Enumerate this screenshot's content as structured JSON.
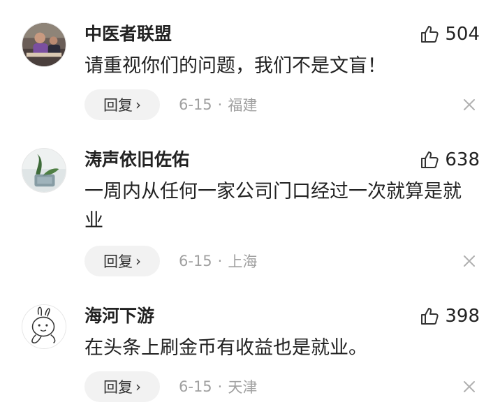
{
  "comments": [
    {
      "username": "中医者联盟",
      "likes": "504",
      "text": "请重视你们的问题，我们不是文盲！",
      "reply_label": "回复",
      "chevron": "›",
      "date": "6-15",
      "separator": "·",
      "location": "福建",
      "avatar_icon": "photo-avatar"
    },
    {
      "username": "涛声依旧佐佑",
      "likes": "638",
      "text": "一周内从任何一家公司门口经过一次就算是就业",
      "reply_label": "回复",
      "chevron": "›",
      "date": "6-15",
      "separator": "·",
      "location": "上海",
      "avatar_icon": "plant-avatar"
    },
    {
      "username": "海河下游",
      "likes": "398",
      "text": "在头条上刷金币有收益也是就业。",
      "reply_label": "回复",
      "chevron": "›",
      "date": "6-15",
      "separator": "·",
      "location": "天津",
      "avatar_icon": "cartoon-rabbit-avatar"
    }
  ],
  "colors": {
    "text": "#222222",
    "meta": "#a0a0a0",
    "reply_bg": "#f2f2f2",
    "icon": "#333333"
  }
}
